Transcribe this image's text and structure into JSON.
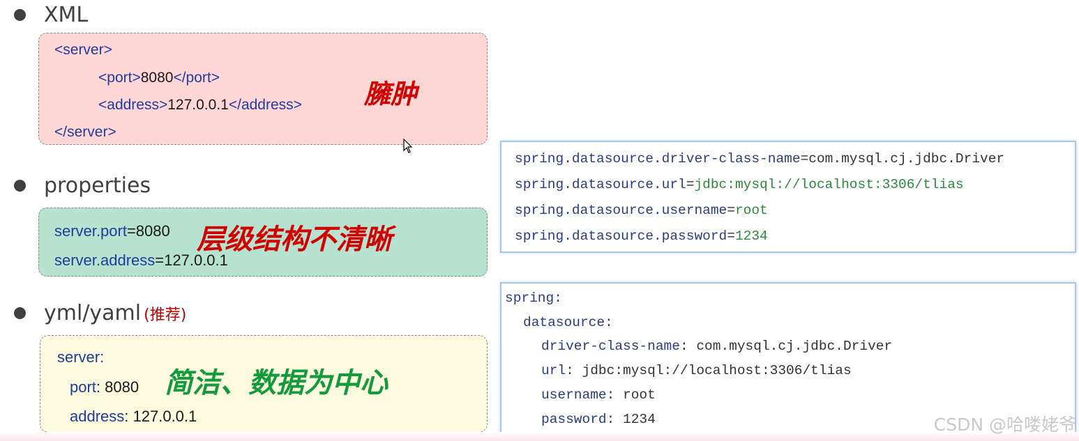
{
  "xml": {
    "heading": "XML",
    "lines": [
      "<server>",
      "<port>",
      "8080",
      "</port>",
      "<address>",
      "127.0.0.1",
      "</address>",
      "</server>"
    ],
    "note": "臃肿"
  },
  "properties": {
    "heading": "properties",
    "line1_key": "server.port",
    "line1_rest": "=8080",
    "line2_key": "server.address",
    "line2_rest": "=127.0.0.1",
    "note": "层级结构不清晰"
  },
  "yml": {
    "heading": "yml/yaml",
    "recommend": "(推荐)",
    "server": "server:",
    "port_key": "port",
    "port_val": "8080",
    "address_key": "address",
    "address_val": "127.0.0.1",
    "note": "简洁、数据为中心"
  },
  "properties_code": {
    "rows": [
      {
        "key": "spring.datasource.driver-class-name",
        "eq": "=",
        "val": "com.mysql.cj.jdbc.Driver"
      },
      {
        "key": "spring.datasource.url",
        "eq": "=",
        "val": "jdbc:mysql://localhost:3306/tlias"
      },
      {
        "key": "spring.datasource.username",
        "eq": "=",
        "val": "root"
      },
      {
        "key": "spring.datasource.password",
        "eq": "=",
        "val": "1234"
      }
    ]
  },
  "yml_code": {
    "spring": "spring:",
    "datasource": "datasource:",
    "driver_key": "driver-class-name",
    "driver_val": ": com.mysql.cj.jdbc.Driver",
    "url_key": "url",
    "url_val": ": jdbc:mysql://localhost:3306/tlias",
    "user_key": "username",
    "user_val": ": root",
    "pass_key": "password",
    "pass_val": ": 1234"
  },
  "watermark": "CSDN @哈喽姥爷",
  "colors": {
    "xml_bg": "#ffd6d6",
    "properties_bg": "#b7e2cf",
    "yml_bg": "#fdfbe0",
    "note_red": "#d20000",
    "note_green": "#129a3c"
  }
}
